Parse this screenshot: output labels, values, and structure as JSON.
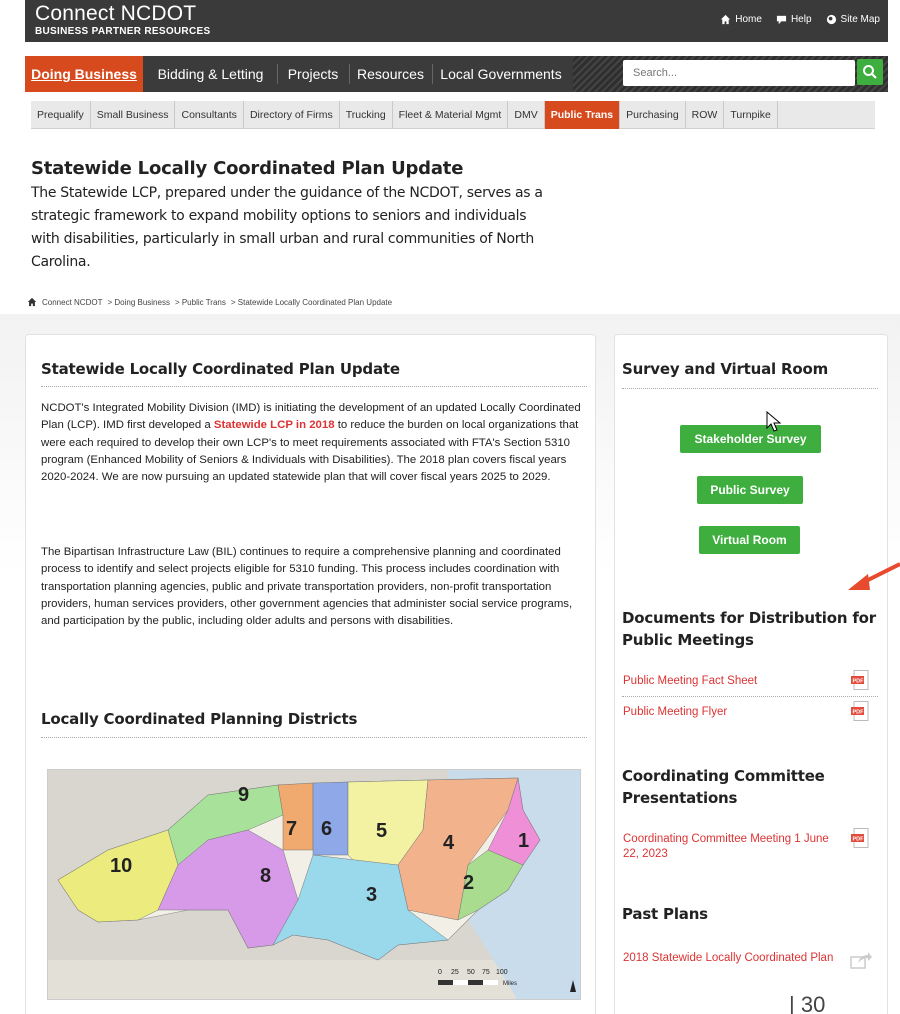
{
  "brand": {
    "name": "Connect NCDOT",
    "subtitle": "BUSINESS PARTNER RESOURCES"
  },
  "utility_links": [
    {
      "label": "Home",
      "icon": "home-icon"
    },
    {
      "label": "Help",
      "icon": "chat-icon"
    },
    {
      "label": "Site Map",
      "icon": "globe-icon"
    }
  ],
  "main_nav": [
    "Doing Business",
    "Bidding & Letting",
    "Projects",
    "Resources",
    "Local Governments"
  ],
  "search": {
    "placeholder": "Search..."
  },
  "sub_nav": [
    "Prequalify",
    "Small Business",
    "Consultants",
    "Directory of Firms",
    "Trucking",
    "Fleet & Material Mgmt",
    "DMV",
    "Public Trans",
    "Purchasing",
    "ROW",
    "Turnpike"
  ],
  "intro": {
    "title": "Statewide Locally Coordinated Plan Update",
    "text": "The Statewide LCP, prepared under the guidance of the NCDOT, serves as a strategic framework to expand mobility options to seniors and individuals with disabilities, particularly in small urban and rural communities of North Carolina."
  },
  "breadcrumb": [
    "Connect NCDOT",
    "> Doing Business",
    "> Public Trans",
    "> Statewide Locally Coordinated Plan Update"
  ],
  "main": {
    "heading": "Statewide Locally Coordinated Plan Update",
    "para1_a": "NCDOT's Integrated Mobility Division (IMD) is initiating the development of an updated Locally Coordinated Plan (LCP). IMD first developed a ",
    "para1_link": "Statewide LCP in 2018",
    "para1_b": " to reduce the burden on local organizations that were each required to develop their own LCP's to meet requirements associated with FTA's Section 5310 program (Enhanced Mobility of Seniors & Individuals with Disabilities). The 2018 plan covers fiscal years 2020-2024. We are now pursuing an updated statewide plan that will cover fiscal years 2025 to 2029.",
    "para2": "The Bipartisan Infrastructure Law (BIL) continues to require a comprehensive planning and coordinated process to identify and select projects eligible for 5310 funding. This process includes coordination with transportation planning agencies, public and private transportation providers, non-profit transportation providers, human services providers, other government agencies that administer social service programs, and participation by the public, including older adults and persons with disabilities.",
    "districts_heading": "Locally Coordinated Planning Districts",
    "map_numbers": [
      "1",
      "2",
      "3",
      "4",
      "5",
      "6",
      "7",
      "8",
      "9",
      "10"
    ],
    "map_scale": {
      "ticks": [
        "0",
        "25",
        "50",
        "75",
        "100"
      ],
      "unit": "Miles"
    }
  },
  "sidebar": {
    "survey_heading": "Survey and Virtual Room",
    "buttons": [
      "Stakeholder Survey",
      "Public Survey",
      "Virtual Room"
    ],
    "docs_heading": "Documents for Distribution for Public Meetings",
    "docs": [
      "Public Meeting Fact Sheet",
      "Public Meeting Flyer"
    ],
    "committee_heading": "Coordinating Committee Presentations",
    "committee_docs": [
      "Coordinating Committee Meeting 1 June 22, 2023"
    ],
    "past_heading": "Past Plans",
    "past_docs": [
      "2018 Statewide Locally Coordinated Plan"
    ],
    "pdf_label": "PDF"
  },
  "page_number": "| 30",
  "colors": {
    "accent": "#d74a1e",
    "green": "#3eae3e",
    "link": "#dd3333",
    "nav": "#3b3b3b"
  }
}
